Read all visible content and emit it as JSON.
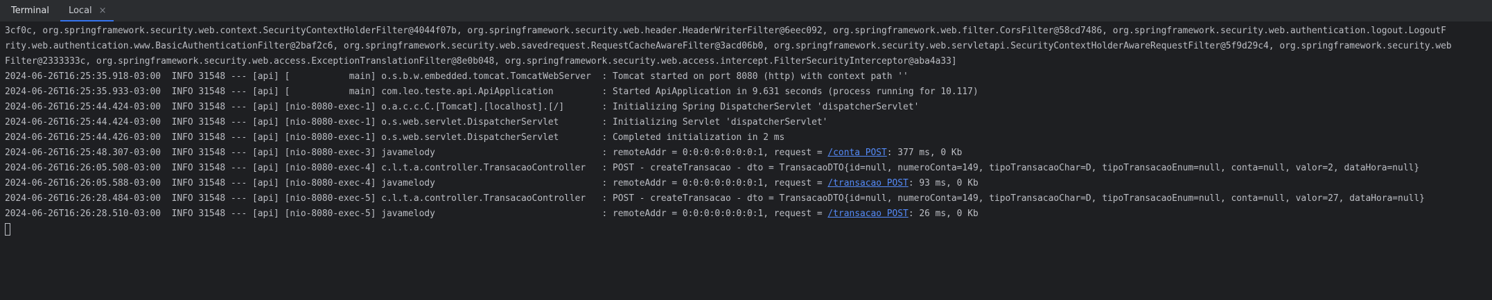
{
  "tool_window": {
    "title": "Terminal",
    "tabs": [
      {
        "label": "Local",
        "close": "×"
      }
    ]
  },
  "console": {
    "lines": [
      {
        "text": "3cf0c, org.springframework.security.web.context.SecurityContextHolderFilter@4044f07b, org.springframework.security.web.header.HeaderWriterFilter@6eec092, org.springframework.web.filter.CorsFilter@58cd7486, org.springframework.security.web.authentication.logout.LogoutF"
      },
      {
        "text": "rity.web.authentication.www.BasicAuthenticationFilter@2baf2c6, org.springframework.security.web.savedrequest.RequestCacheAwareFilter@3acd06b0, org.springframework.security.web.servletapi.SecurityContextHolderAwareRequestFilter@5f9d29c4, org.springframework.security.web"
      },
      {
        "text": "Filter@2333333c, org.springframework.security.web.access.ExceptionTranslationFilter@8e0b048, org.springframework.security.web.access.intercept.FilterSecurityInterceptor@aba4a33]"
      },
      {
        "text": "2024-06-26T16:25:35.918-03:00  INFO 31548 --- [api] [           main] o.s.b.w.embedded.tomcat.TomcatWebServer  : Tomcat started on port 8080 (http) with context path ''"
      },
      {
        "text": "2024-06-26T16:25:35.933-03:00  INFO 31548 --- [api] [           main] com.leo.teste.api.ApiApplication         : Started ApiApplication in 9.631 seconds (process running for 10.117)"
      },
      {
        "text": "2024-06-26T16:25:44.424-03:00  INFO 31548 --- [api] [nio-8080-exec-1] o.a.c.c.C.[Tomcat].[localhost].[/]       : Initializing Spring DispatcherServlet 'dispatcherServlet'"
      },
      {
        "text": "2024-06-26T16:25:44.424-03:00  INFO 31548 --- [api] [nio-8080-exec-1] o.s.web.servlet.DispatcherServlet        : Initializing Servlet 'dispatcherServlet'"
      },
      {
        "text": "2024-06-26T16:25:44.426-03:00  INFO 31548 --- [api] [nio-8080-exec-1] o.s.web.servlet.DispatcherServlet        : Completed initialization in 2 ms"
      },
      {
        "pre": "2024-06-26T16:25:48.307-03:00  INFO 31548 --- [api] [nio-8080-exec-3] javamelody                               : remoteAddr = 0:0:0:0:0:0:0:1, request = ",
        "link": "/conta POST",
        "post": ": 377 ms, 0 Kb"
      },
      {
        "text": "2024-06-26T16:26:05.508-03:00  INFO 31548 --- [api] [nio-8080-exec-4] c.l.t.a.controller.TransacaoController   : POST - createTransacao - dto = TransacaoDTO{id=null, numeroConta=149, tipoTransacaoChar=D, tipoTransacaoEnum=null, conta=null, valor=2, dataHora=null}"
      },
      {
        "pre": "2024-06-26T16:26:05.588-03:00  INFO 31548 --- [api] [nio-8080-exec-4] javamelody                               : remoteAddr = 0:0:0:0:0:0:0:1, request = ",
        "link": "/transacao POST",
        "post": ": 93 ms, 0 Kb"
      },
      {
        "text": "2024-06-26T16:26:28.484-03:00  INFO 31548 --- [api] [nio-8080-exec-5] c.l.t.a.controller.TransacaoController   : POST - createTransacao - dto = TransacaoDTO{id=null, numeroConta=149, tipoTransacaoChar=D, tipoTransacaoEnum=null, conta=null, valor=27, dataHora=null}"
      },
      {
        "pre": "2024-06-26T16:26:28.510-03:00  INFO 31548 --- [api] [nio-8080-exec-5] javamelody                               : remoteAddr = 0:0:0:0:0:0:0:1, request = ",
        "link": "/transacao POST",
        "post": ": 26 ms, 0 Kb"
      }
    ]
  },
  "colors": {
    "background": "#1e1f22",
    "tabbar": "#2b2d30",
    "text": "#bcbec4",
    "link": "#548af7",
    "accent": "#3574f0"
  }
}
